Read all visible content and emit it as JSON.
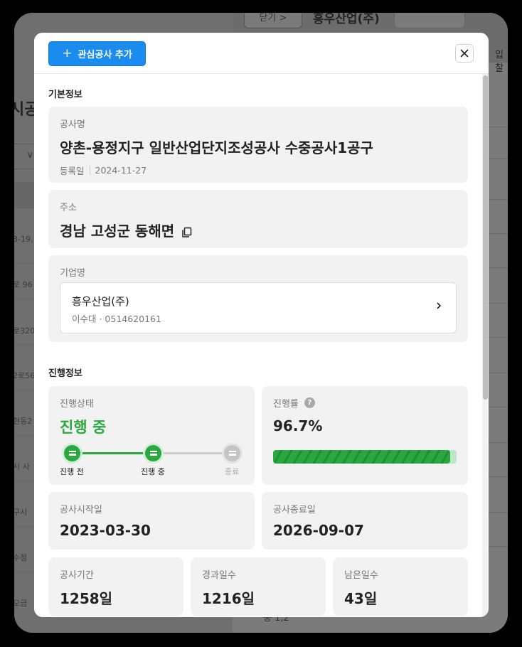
{
  "background": {
    "pill_label": "닫기 >",
    "company_title": "흥우산업(주)",
    "tab_text": "입찰",
    "page_title": "시공",
    "select_chevron": "∨",
    "rows": [
      "3-19,",
      "로 96",
      "로320",
      "2로56",
      "현동2",
      "시 사",
      "구시",
      "수정",
      "오금"
    ],
    "bottom_text": "중 1,2"
  },
  "modal": {
    "add_button_label": "관심공사 추가",
    "add_button_icon": "plus-icon",
    "close_icon": "close-icon",
    "basic_section_title": "기본정보",
    "project": {
      "label": "공사명",
      "name": "양촌-용정지구 일반산업단지조성공사 수중공사1공구",
      "reg_label": "등록일",
      "reg_date": "2024-11-27"
    },
    "address": {
      "label": "주소",
      "value": "경남 고성군 동해면",
      "copy_icon": "copy-icon"
    },
    "company": {
      "label": "기업명",
      "name": "흥우산업(주)",
      "sub": "이수대 · 0514620161",
      "chevron_icon": "chevron-right-icon"
    },
    "progress_section_title": "진행정보",
    "status": {
      "label": "진행상태",
      "value": "진행 중",
      "steps": [
        "진행 전",
        "진행 중",
        "종료"
      ],
      "current_step": 2
    },
    "rate": {
      "label": "진행률",
      "help_icon": "help-icon",
      "help_glyph": "?",
      "value": "96.7%",
      "fraction": 0.967
    },
    "start_date": {
      "label": "공사시작일",
      "value": "2023-03-30"
    },
    "end_date": {
      "label": "공사종료일",
      "value": "2026-09-07"
    },
    "duration": {
      "label": "공사기간",
      "value": "1258일"
    },
    "elapsed": {
      "label": "경과일수",
      "value": "1216일"
    },
    "remaining": {
      "label": "남은일수",
      "value": "43일"
    }
  },
  "colors": {
    "accent_blue": "#1a8cf0",
    "status_green": "#2aa83f",
    "inactive_gray": "#c4c4c4"
  }
}
